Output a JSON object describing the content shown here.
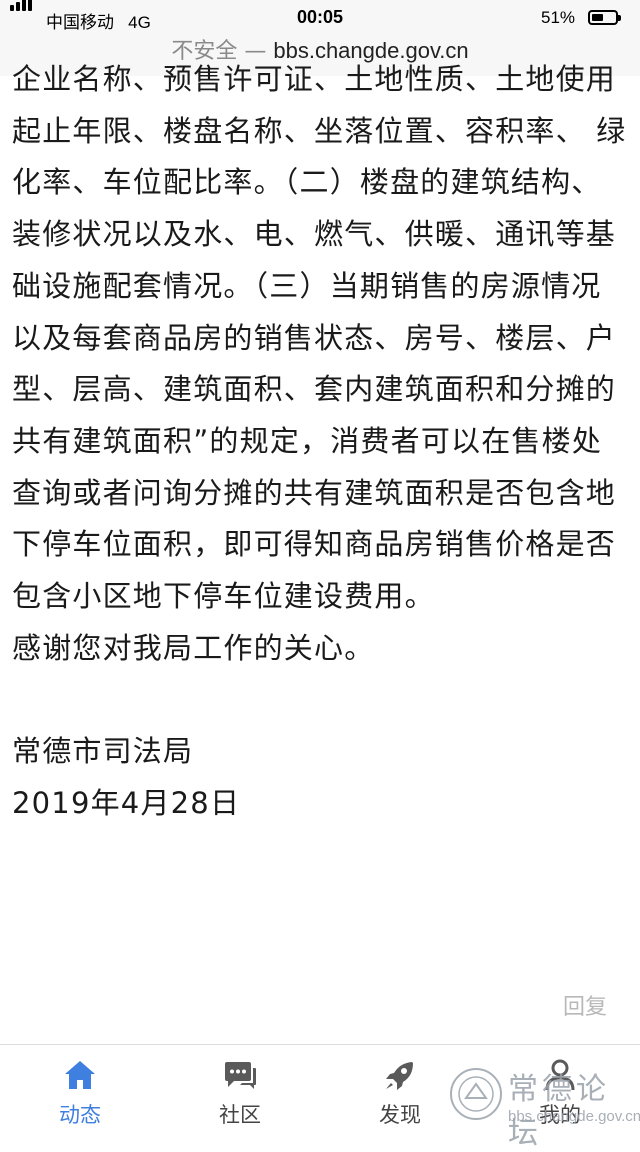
{
  "status_bar": {
    "carrier": "中国移动",
    "network": "4G",
    "time": "00:05",
    "battery_percent": "51%",
    "battery_level": 0.51
  },
  "url_bar": {
    "security_label": "不安全",
    "separator": "—",
    "host": "bbs.changde.gov.cn"
  },
  "post": {
    "paragraphs": [
      "企业名称、预售许可证、土地性质、土地使用起止年限、楼盘名称、坐落位置、容积率、 绿化率、车位配比率。（二）楼盘的建筑结构、装修状况以及水、电、燃气、供暖、通讯等基础设施配套情况。（三）当期销售的房源情况以及每套商品房的销售状态、房号、楼层、户型、层高、建筑面积、套内建筑面积和分摊的共有建筑面积”的规定，消费者可以在售楼处查询或者问询分摊的共有建筑面积是否包含地下停车位面积，即可得知商品房销售价格是否包含小区地下停车位建设费用。",
      "感谢您对我局工作的关心。",
      "常德市司法局",
      "2019年4月28日"
    ],
    "reply_label": "回复"
  },
  "tab_bar": {
    "tabs": [
      {
        "label": "动态",
        "icon": "home-icon",
        "active": true
      },
      {
        "label": "社区",
        "icon": "chat-icon",
        "active": false
      },
      {
        "label": "发现",
        "icon": "rocket-icon",
        "active": false
      },
      {
        "label": "我的",
        "icon": "person-icon",
        "active": false
      }
    ]
  },
  "watermark": {
    "text": "常德论坛",
    "url": "bbs.changde.gov.cn"
  },
  "colors": {
    "accent": "#3f7fe0",
    "icon_gray": "#5a5a5a",
    "muted": "#b8b8b8"
  }
}
